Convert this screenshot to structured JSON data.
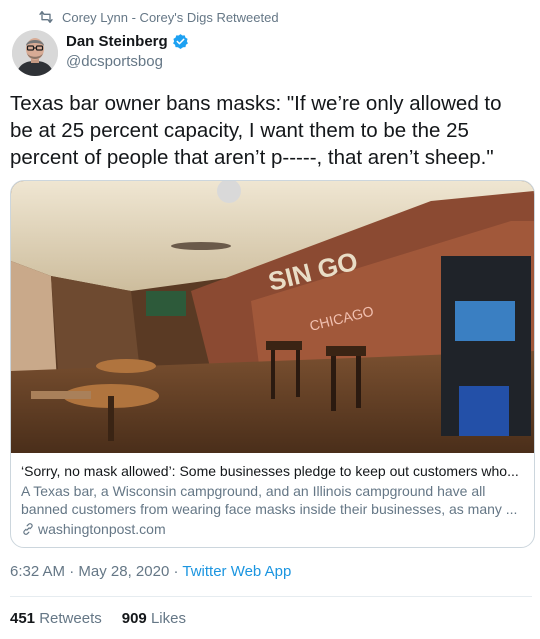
{
  "retweet": {
    "text": "Corey Lynn - Corey's Digs Retweeted",
    "icon": "retweet-icon"
  },
  "author": {
    "name": "Dan Steinberg",
    "handle": "@dcsportsbog",
    "verified_icon": "verified-badge-icon"
  },
  "tweet": {
    "text": "Texas bar owner bans masks: \"If we’re only allowed to be at 25 percent capacity, I want them to be the 25 percent of people that aren’t p-----, that aren’t sheep.\""
  },
  "card": {
    "title": "‘Sorry, no mask allowed’: Some businesses pledge to keep out customers who...",
    "description": "A Texas bar, a Wisconsin campground, and an Illinois campground have all banned customers from wearing face masks inside their businesses, as many ...",
    "domain": "washingtonpost.com",
    "domain_icon": "link-icon"
  },
  "meta": {
    "time": "6:32 AM",
    "separator": " · ",
    "date": "May 28, 2020",
    "source": "Twitter Web App"
  },
  "stats": {
    "retweets": "451",
    "retweets_label": "Retweets",
    "likes": "909",
    "likes_label": "Likes"
  },
  "colors": {
    "link": "#1b95e0",
    "secondary": "#657786",
    "text": "#14171a",
    "border": "#ccd6dd"
  }
}
